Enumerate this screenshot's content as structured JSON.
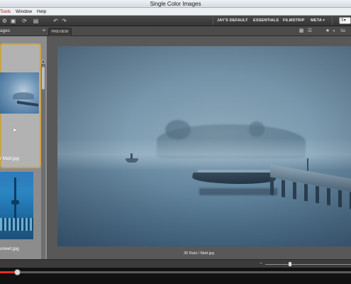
{
  "window": {
    "title": "Single Color Images"
  },
  "menu": {
    "items": [
      "Tools",
      "Window",
      "Help"
    ]
  },
  "toolbar": {
    "workspaces": [
      "JAY'S DEFAULT",
      "ESSENTIALS",
      "FILMSTRIP",
      "META"
    ],
    "icons": [
      "gear-icon",
      "refresh-icon",
      "document-icon",
      "undo-icon",
      "redo-icon",
      "grid-view-icon",
      "list-view-icon",
      "star-icon",
      "search-icon"
    ],
    "search_text": "ℛ▾"
  },
  "panel_header": {
    "content_label": "ages",
    "preview_tab": "PREVIEW",
    "right_text": "So"
  },
  "content_panel": {
    "thumbnails": [
      {
        "label": "/ Matt.jpg",
        "selected": true
      },
      {
        "label": "uneet.jpg",
        "selected": false
      }
    ],
    "accent": "#c9a44a"
  },
  "preview": {
    "caption": "30 Rabi / Matt.jpg"
  },
  "player": {
    "progress": 0.05,
    "accent": "#e52d27"
  },
  "status": {
    "zoom_minus": "−"
  }
}
